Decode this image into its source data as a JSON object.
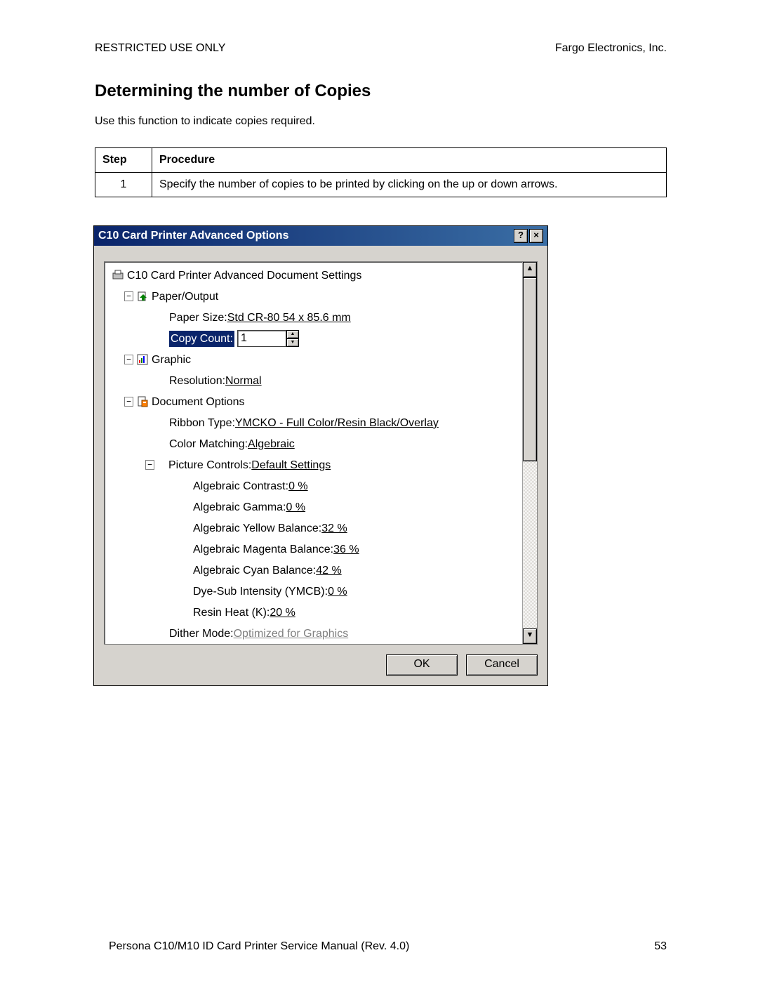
{
  "header": {
    "left": "RESTRICTED USE ONLY",
    "right": "Fargo Electronics, Inc."
  },
  "section_title": "Determining the number of Copies",
  "intro": "Use this function to indicate copies required.",
  "table": {
    "col_step": "Step",
    "col_proc": "Procedure",
    "rows": [
      {
        "num": "1",
        "text": "Specify the number of copies to be printed by clicking on the up or down arrows."
      }
    ]
  },
  "dialog": {
    "title": "C10 Card Printer Advanced Options",
    "help": "?",
    "close": "×",
    "ok": "OK",
    "cancel": "Cancel",
    "scroll_up": "▲",
    "scroll_down": "▼"
  },
  "tree": {
    "root": "C10 Card Printer Advanced Document Settings",
    "paper_output": "Paper/Output",
    "paper_size_label": "Paper Size: ",
    "paper_size_value": "Std CR-80  54 x 85.6 mm",
    "copy_count_label": "Copy Count: ",
    "copy_count_value": "1",
    "graphic": "Graphic",
    "resolution_label": "Resolution: ",
    "resolution_value": "Normal",
    "doc_options": "Document Options",
    "ribbon_label": "Ribbon Type: ",
    "ribbon_value": "YMCKO - Full Color/Resin Black/Overlay",
    "color_match_label": "Color Matching: ",
    "color_match_value": "Algebraic",
    "picture_controls_label": "Picture Controls: ",
    "picture_controls_value": "Default Settings",
    "contrast_label": "Algebraic Contrast: ",
    "contrast_value": "0 %",
    "gamma_label": "Algebraic Gamma: ",
    "gamma_value": "0 %",
    "yellow_label": "Algebraic Yellow Balance: ",
    "yellow_value": "32 %",
    "magenta_label": "Algebraic Magenta Balance: ",
    "magenta_value": "36 %",
    "cyan_label": "Algebraic Cyan Balance: ",
    "cyan_value": "42 %",
    "dyesub_label": "Dye-Sub Intensity (YMCB): ",
    "dyesub_value": "0 %",
    "resin_label": "Resin Heat (K): ",
    "resin_value": "20 %",
    "dither_label": "Dither Mode: ",
    "dither_value": "Optimized for Graphics"
  },
  "footer": {
    "left": "Persona C10/M10 ID Card Printer Service Manual (Rev. 4.0)",
    "right": "53"
  }
}
